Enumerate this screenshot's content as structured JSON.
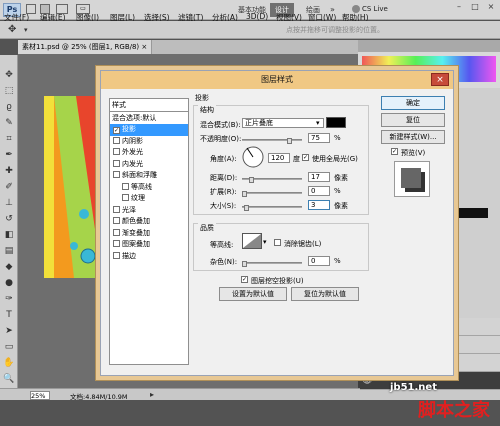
{
  "app": {
    "logo": "Ps",
    "cs_live": "CS Live"
  },
  "menubar": {
    "items": [
      "文件(F)",
      "编辑(E)",
      "图像(I)",
      "图层(L)",
      "选择(S)",
      "滤镜(T)",
      "分析(A)",
      "3D(D)",
      "视图(V)",
      "窗口(W)",
      "帮助(H)"
    ],
    "workspaces": [
      "基本功能",
      "设计",
      "绘画"
    ]
  },
  "options_bar": {
    "hint": "点按并拖移可调整投影的位置。"
  },
  "document_tab": {
    "title": "素材11.psd @ 25% (图层1, RGB/8) ×"
  },
  "status": {
    "zoom": "25%",
    "doc_info": "文档:4.84M/10.9M"
  },
  "dialog": {
    "title": "图层样式",
    "styles_header": "样式",
    "blend_options": "混合选项:默认",
    "styles": [
      {
        "label": "投影",
        "checked": true,
        "selected": true,
        "indent": false
      },
      {
        "label": "内阴影",
        "checked": false,
        "selected": false,
        "indent": false
      },
      {
        "label": "外发光",
        "checked": false,
        "selected": false,
        "indent": false
      },
      {
        "label": "内发光",
        "checked": false,
        "selected": false,
        "indent": false
      },
      {
        "label": "斜面和浮雕",
        "checked": false,
        "selected": false,
        "indent": false
      },
      {
        "label": "等高线",
        "checked": false,
        "selected": false,
        "indent": true
      },
      {
        "label": "纹理",
        "checked": false,
        "selected": false,
        "indent": true
      },
      {
        "label": "光泽",
        "checked": false,
        "selected": false,
        "indent": false
      },
      {
        "label": "颜色叠加",
        "checked": false,
        "selected": false,
        "indent": false
      },
      {
        "label": "渐变叠加",
        "checked": false,
        "selected": false,
        "indent": false
      },
      {
        "label": "图案叠加",
        "checked": false,
        "selected": false,
        "indent": false
      },
      {
        "label": "描边",
        "checked": false,
        "selected": false,
        "indent": false
      }
    ],
    "section_title": "投影",
    "structure_title": "结构",
    "blend_mode_label": "混合模式(B):",
    "blend_mode_value": "正片叠底",
    "shadow_color": "#000000",
    "opacity_label": "不透明度(O):",
    "opacity_value": "75",
    "angle_label": "角度(A):",
    "angle_value": "120",
    "degree_unit": "度",
    "global_light_label": "使用全局光(G)",
    "distance_label": "距离(D):",
    "distance_value": "17",
    "spread_label": "扩展(R):",
    "spread_value": "0",
    "size_label": "大小(S):",
    "size_value": "3",
    "percent_unit": "%",
    "pixel_unit": "像素",
    "quality_title": "品质",
    "contour_label": "等高线:",
    "antialias_label": "消除锯齿(L)",
    "noise_label": "杂色(N):",
    "noise_value": "0",
    "knockout_label": "图层挖空投影(U)",
    "set_default_button": "设置为默认值",
    "reset_default_button": "复位为默认值",
    "ok_button": "确定",
    "reset_button": "复位",
    "new_style_button": "新建样式(W)...",
    "preview_label": "预览(V)"
  },
  "watermark": {
    "line1": "jb51.net",
    "line2": "脚本之家"
  }
}
